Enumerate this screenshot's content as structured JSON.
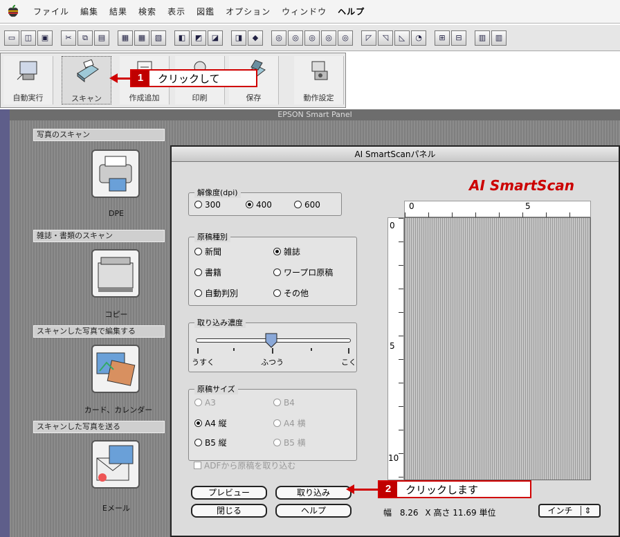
{
  "menubar": {
    "items": [
      "ファイル",
      "編集",
      "結果",
      "検索",
      "表示",
      "図鑑",
      "オプション",
      "ウィンドウ",
      "ヘルプ"
    ]
  },
  "palette": {
    "buttons": [
      "自動実行",
      "スキャン",
      "作成追加",
      "印刷",
      "保存",
      "動作設定"
    ]
  },
  "window": {
    "title": "EPSON Smart Panel"
  },
  "sections": [
    {
      "header": "写真のスキャン",
      "label": "DPE"
    },
    {
      "header": "雑誌・書類のスキャン",
      "label": "コピー"
    },
    {
      "header": "スキャンした写真で編集する",
      "label": "カード、カレンダー"
    },
    {
      "header": "スキャンした写真を送る",
      "label": "Eメール"
    }
  ],
  "dialog": {
    "title": "AI SmartScanパネル",
    "logo": "AI SmartScan",
    "resolution": {
      "label": "解像度(dpi)",
      "options": [
        "300",
        "400",
        "600"
      ],
      "selected": "400"
    },
    "doc_type": {
      "label": "原稿種別",
      "options": [
        "新聞",
        "雑誌",
        "書籍",
        "ワープロ原稿",
        "自動判別",
        "その他"
      ],
      "selected": "雑誌"
    },
    "density": {
      "label": "取り込み濃度",
      "ticks": [
        "うすく",
        "ふつう",
        "こく"
      ]
    },
    "doc_size": {
      "label": "原稿サイズ",
      "options": [
        "A3",
        "B4",
        "A4 縦",
        "A4 横",
        "B5 縦",
        "B5 横"
      ],
      "selected": "A4 縦"
    },
    "adf": {
      "label": "ADFから原稿を取り込む"
    },
    "buttons": {
      "preview": "プレビュー",
      "capture": "取り込み",
      "close": "閉じる",
      "help": "ヘルプ"
    },
    "ruler": {
      "top": [
        "0",
        "5"
      ],
      "left": [
        "0",
        "5",
        "10"
      ]
    },
    "size_info": {
      "width_label": "幅",
      "width": "8.26",
      "x": "X",
      "height_label": "高さ",
      "height": "11.69",
      "unit_label": "単位",
      "unit": "インチ"
    }
  },
  "callouts": [
    {
      "num": "1",
      "text": "クリックして"
    },
    {
      "num": "2",
      "text": "クリックします"
    }
  ],
  "colors": {
    "callout_red": "#d00000",
    "logo_red": "#cc0000",
    "dialog_bg": "#dcdcdc"
  }
}
